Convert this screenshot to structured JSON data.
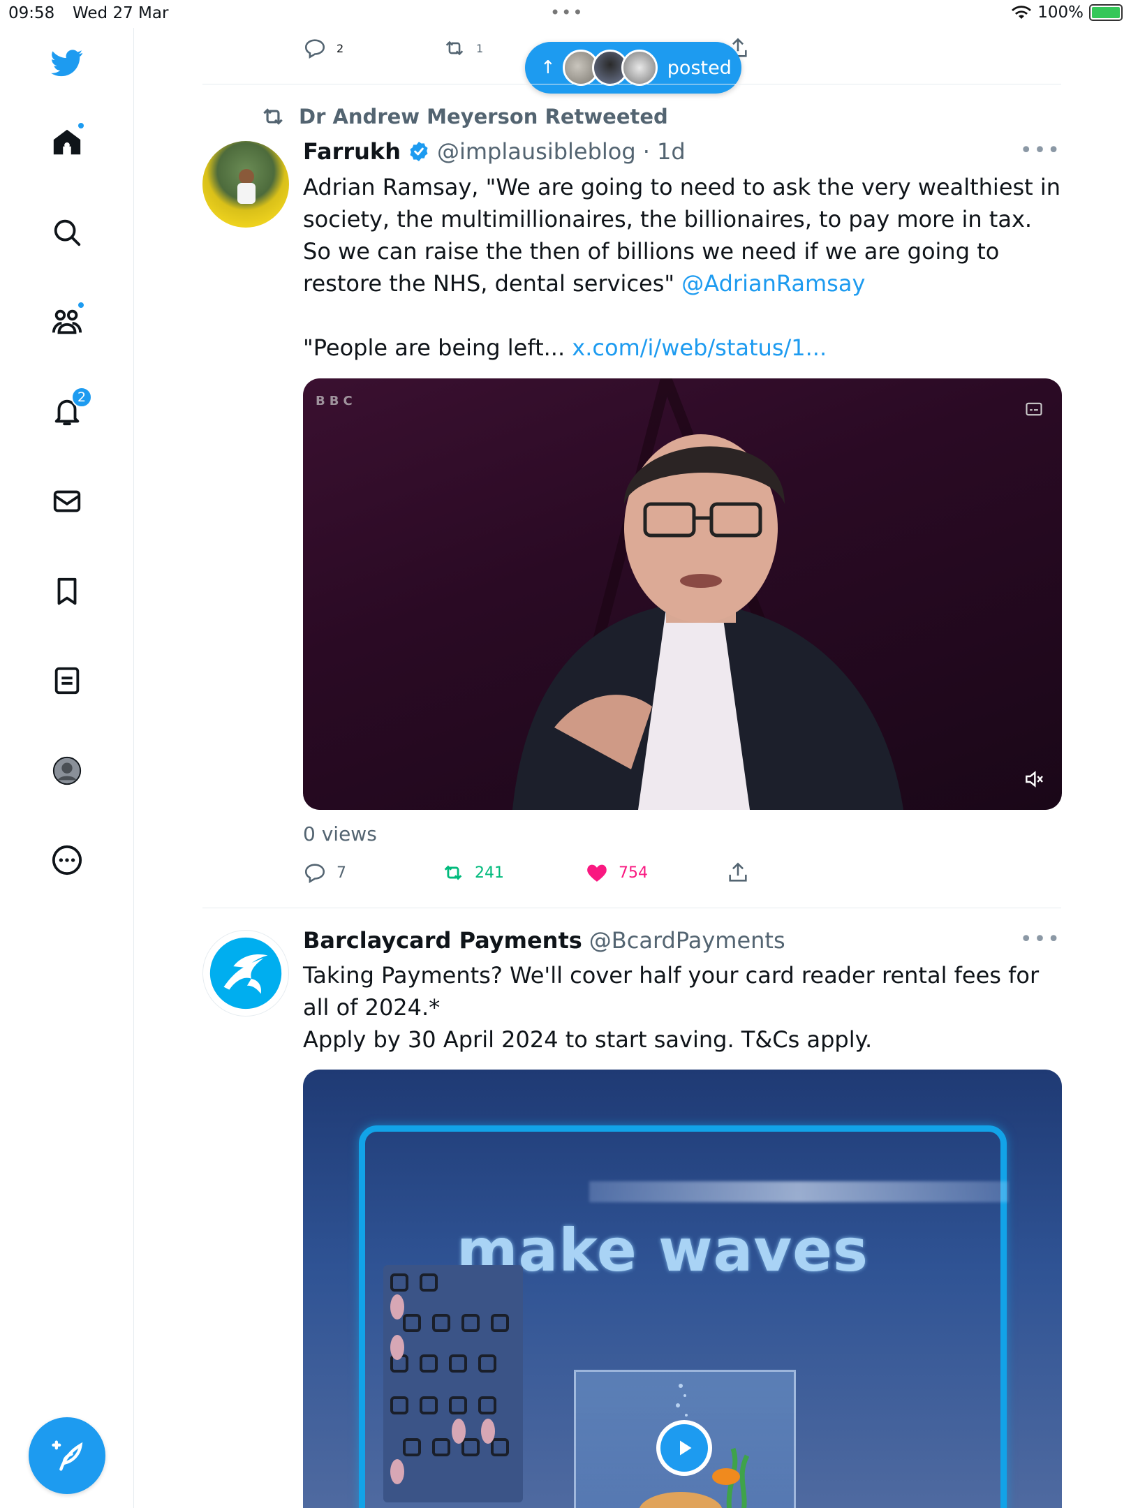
{
  "status_bar": {
    "time": "09:58",
    "date": "Wed 27 Mar",
    "battery": "100%"
  },
  "sidebar": {
    "notifications_badge": "2"
  },
  "new_posts_pill": {
    "label": "posted"
  },
  "prev_tweet": {
    "replies": "2",
    "retweets": "1"
  },
  "tweet1": {
    "retweeted_by": "Dr Andrew Meyerson Retweeted",
    "name": "Farrukh",
    "handle": "@implausibleblog",
    "time": "· 1d",
    "text_main": "Adrian Ramsay, \"We are going to need to ask the very wealthiest in society, the multimillionaires, the billionaires, to pay more in tax. So we can raise the then of billions we need if we are going to restore the NHS, dental services\" ",
    "mention": "@AdrianRamsay",
    "text_quote": "\"People are being left... ",
    "link": "x.com/i/web/status/1...",
    "video_logo": "BBC",
    "views": "0 views",
    "replies": "7",
    "retweets": "241",
    "likes": "754"
  },
  "tweet2": {
    "name": "Barclaycard Payments",
    "handle": "@BcardPayments",
    "text_line1": "Taking Payments? We'll cover half your card reader rental fees for all of 2024.*",
    "text_line2": "Apply by 30 April 2024 to start saving. T&Cs apply.",
    "media_text": "make waves"
  },
  "colors": {
    "accent": "#1d9bf0",
    "retweet_green": "#00ba7c",
    "like_pink": "#f91880"
  }
}
